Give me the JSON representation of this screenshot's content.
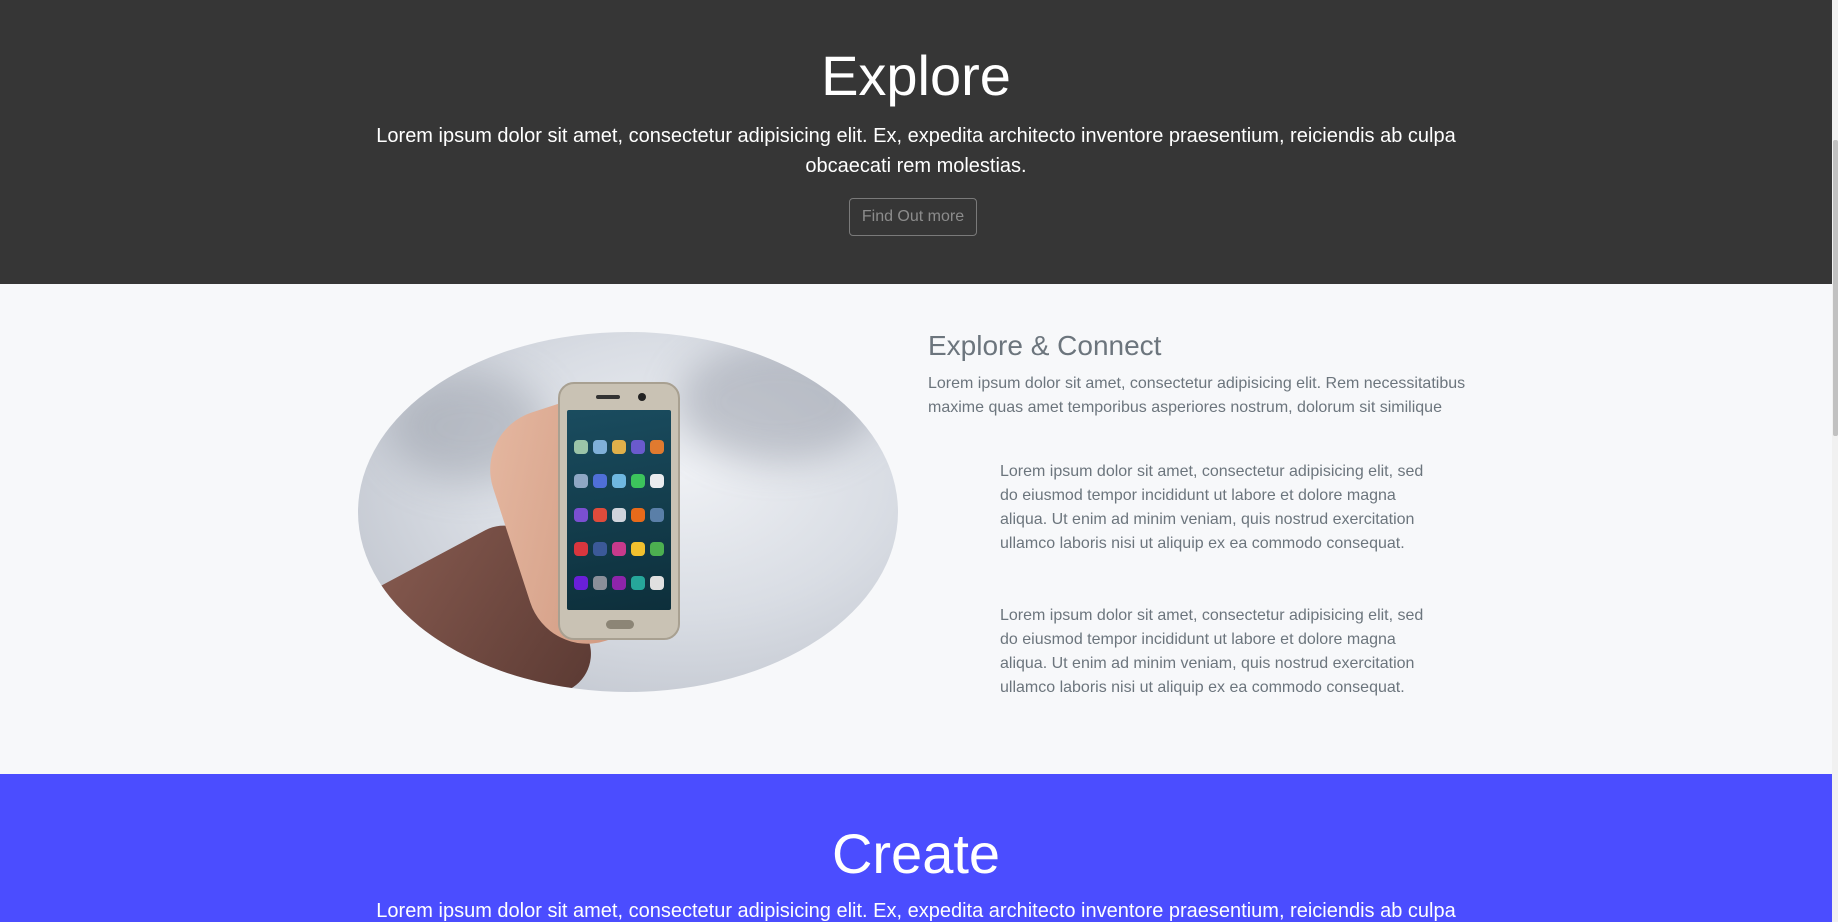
{
  "explore": {
    "title": "Explore",
    "text": "Lorem ipsum dolor sit amet, consectetur adipisicing elit. Ex, expedita architecto inventore praesentium, reiciendis ab culpa obcaecati rem molestias.",
    "button_label": "Find Out more"
  },
  "feature": {
    "heading": "Explore & Connect",
    "lead": "Lorem ipsum dolor sit amet, consectetur adipisicing elit. Rem necessitatibus maxime quas amet temporibus asperiores nostrum, dolorum sit similique",
    "paragraphs": [
      "Lorem ipsum dolor sit amet, consectetur adipisicing elit, sed do eiusmod tempor incididunt ut labore et dolore magna aliqua. Ut enim ad minim veniam, quis nostrud exercitation ullamco laboris nisi ut aliquip ex ea commodo consequat.",
      "Lorem ipsum dolor sit amet, consectetur adipisicing elit, sed do eiusmod tempor incididunt ut labore et dolore magna aliqua. Ut enim ad minim veniam, quis nostrud exercitation ullamco laboris nisi ut aliquip ex ea commodo consequat."
    ],
    "image": "hand-holding-smartphone-photo"
  },
  "create": {
    "title": "Create",
    "text": "Lorem ipsum dolor sit amet, consectetur adipisicing elit. Ex, expedita architecto inventore praesentium, reiciendis ab culpa"
  },
  "colors": {
    "dark_section": "#363636",
    "light_section": "#f7f8fa",
    "blue_section": "#4b4dff",
    "muted_text": "#6c757d"
  }
}
